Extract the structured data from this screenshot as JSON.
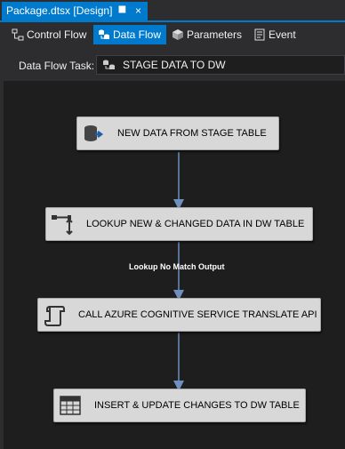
{
  "document_tab": {
    "title": "Package.dtsx [Design]",
    "pin_icon": "pin-icon",
    "close_glyph": "×"
  },
  "designer_tabs": [
    {
      "label": "Control Flow",
      "icon": "control-flow-icon",
      "active": false
    },
    {
      "label": "Data Flow",
      "icon": "data-flow-icon",
      "active": true
    },
    {
      "label": "Parameters",
      "icon": "parameters-icon",
      "active": false
    },
    {
      "label": "Event Handlers",
      "icon": "event-handlers-icon",
      "active": false
    }
  ],
  "task_selector": {
    "label": "Data Flow Task:",
    "value": "STAGE DATA TO DW",
    "icon": "data-flow-task-icon"
  },
  "flow": {
    "nodes": [
      {
        "label": "NEW DATA FROM STAGE TABLE",
        "icon": "ole-db-source-icon"
      },
      {
        "label": "LOOKUP NEW & CHANGED DATA IN DW TABLE",
        "icon": "lookup-icon"
      },
      {
        "label": "CALL AZURE COGNITIVE SERVICE TRANSLATE API",
        "icon": "script-component-icon"
      },
      {
        "label": "INSERT & UPDATE CHANGES TO DW TABLE",
        "icon": "ole-db-destination-icon"
      }
    ],
    "path_label": "Lookup No Match Output"
  },
  "colors": {
    "accent": "#007acc",
    "background": "#2d2d30",
    "canvas": "#1e1e1e",
    "node_fill": "#d8d8d8",
    "connector": "#6f8fbf"
  }
}
